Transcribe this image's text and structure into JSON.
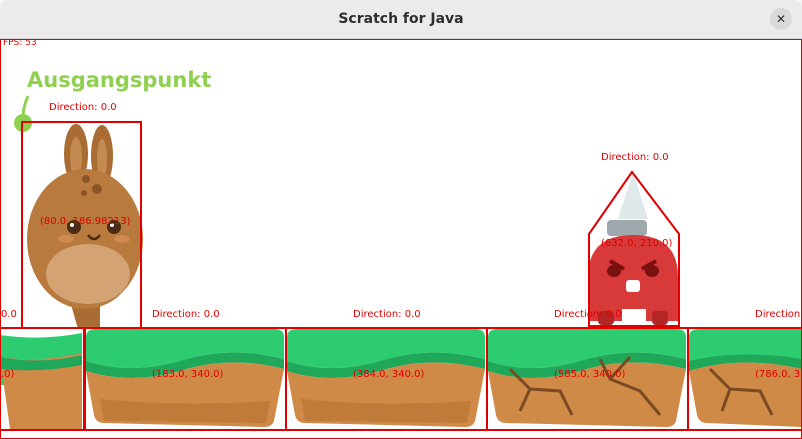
{
  "window": {
    "title": "Scratch for Java",
    "close_icon": "close-icon"
  },
  "stage": {
    "fps_text": "FPS: 53",
    "flag_label": "Ausgangspunkt",
    "sprites": {
      "bunny": {
        "direction": "Direction: 0.0",
        "position": "(80.0, 186.98213)"
      },
      "monster": {
        "direction": "Direction: 0.0",
        "position": "(632.0, 210.0)"
      }
    },
    "ground_tiles": [
      {
        "direction": "",
        "position": ".0)"
      },
      {
        "direction": "Direction: 0.0",
        "position": "(183.0, 340.0)"
      },
      {
        "direction": "Direction: 0.0",
        "position": "(384.0, 340.0)"
      },
      {
        "direction": "Direction: 0.0",
        "position": "(585.0, 340.0)"
      },
      {
        "direction": "Direction",
        "position": "(786.0, 3"
      }
    ],
    "first_tile_direction_clip": "0.0",
    "colors": {
      "debug": "#e00000",
      "grass": "#2ecc71",
      "dirt": "#d08a48",
      "flag": "#8fd14f",
      "monster": "#d83a3a",
      "bunny": "#b97a3e"
    }
  }
}
